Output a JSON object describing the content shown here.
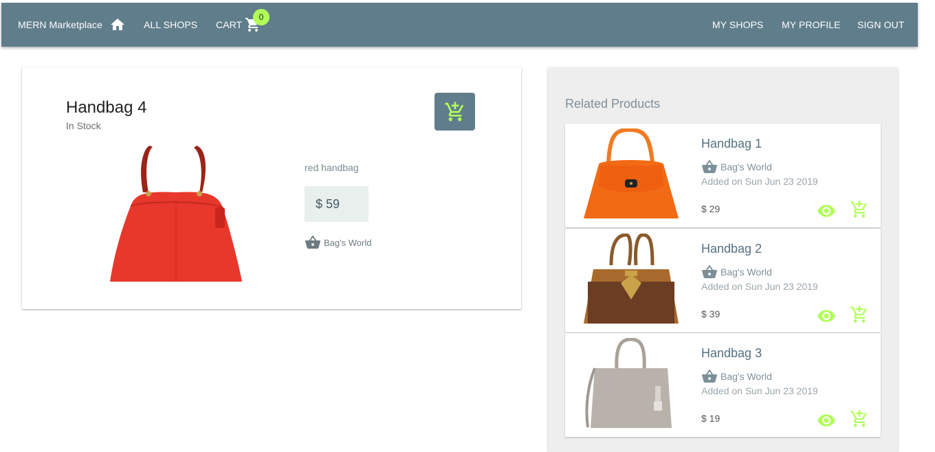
{
  "appbar": {
    "brand": "MERN Marketplace",
    "all_shops": "ALL SHOPS",
    "cart": "CART",
    "cart_count": "0",
    "my_shops": "MY SHOPS",
    "my_profile": "MY PROFILE",
    "sign_out": "SIGN OUT",
    "color": "#607d8b",
    "badge_color": "#b2ff59"
  },
  "product": {
    "name": "Handbag 4",
    "stock": "In Stock",
    "description": "red handbag",
    "price": "$ 59",
    "shop": "Bag's World",
    "image": "red-handbag-image"
  },
  "related": {
    "heading": "Related Products",
    "items": [
      {
        "name": "Handbag 1",
        "shop": "Bag's World",
        "date": "Added on Sun Jun 23 2019",
        "price": "$ 29",
        "image": "orange-handbag-image"
      },
      {
        "name": "Handbag 2",
        "shop": "Bag's World",
        "date": "Added on Sun Jun 23 2019",
        "price": "$ 39",
        "image": "brown-handbag-image"
      },
      {
        "name": "Handbag 3",
        "shop": "Bag's World",
        "date": "Added on Sun Jun 23 2019",
        "price": "$ 19",
        "image": "grey-handbag-image"
      }
    ],
    "accent_color": "#b2ff59"
  }
}
